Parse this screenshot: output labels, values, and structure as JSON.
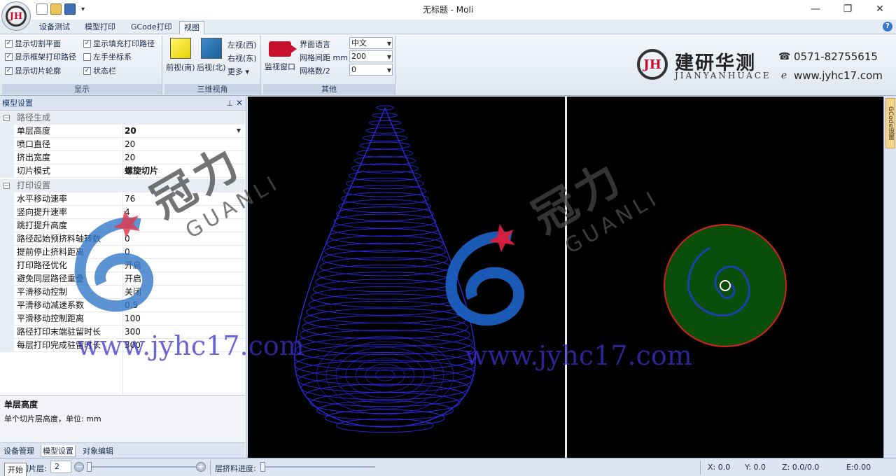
{
  "window": {
    "title": "无标题 - Moli",
    "minimize": "—",
    "maximize": "❐",
    "close": "✕"
  },
  "app_orb": {
    "monogram": "JH"
  },
  "quick_access": {
    "dropdown": "▾"
  },
  "ribbon": {
    "tabs": [
      "设备测试",
      "模型打印",
      "GCode打印",
      "视图"
    ],
    "active_tab": "视图",
    "help": "?",
    "groups": {
      "display": {
        "caption": "显示",
        "checks": [
          {
            "label": "显示切割平面",
            "checked": true
          },
          {
            "label": "显示框架打印路径",
            "checked": true
          },
          {
            "label": "显示切片轮廓",
            "checked": true
          },
          {
            "label": "显示填充打印路径",
            "checked": true
          },
          {
            "label": "左手坐标系",
            "checked": false
          },
          {
            "label": "状态栏",
            "checked": true
          }
        ]
      },
      "view3d": {
        "caption": "三维视角",
        "front": "前视(南)",
        "back": "后视(北)",
        "left": "左视(西)",
        "right": "右视(东)",
        "more": "更多 ▾"
      },
      "other": {
        "caption": "其他",
        "monitor": "监视窗口",
        "language_label": "界面语言",
        "language_value": "中文",
        "grid_spacing_label": "网格间距 mm",
        "grid_spacing_value": "200",
        "grid_count_label": "网格数/2",
        "grid_count_value": "0"
      }
    }
  },
  "brand": {
    "logo_text": "JH",
    "name_cn": "建研华测",
    "name_en": "JIANYANHUACE",
    "phone": "0571-82755615",
    "website": "www.jyhc17.com",
    "accent": "#c8102e"
  },
  "left_panel": {
    "title": "模型设置",
    "pin": "⊥",
    "close": "✕",
    "categories": [
      {
        "name": "路径生成",
        "toggle": "−",
        "props": [
          {
            "name": "单层高度",
            "value": "20",
            "selected": true
          },
          {
            "name": "喷口直径",
            "value": "20"
          },
          {
            "name": "挤出宽度",
            "value": "20"
          },
          {
            "name": "切片模式",
            "value": "螺旋切片",
            "bold": true
          }
        ]
      },
      {
        "name": "打印设置",
        "toggle": "−",
        "props": [
          {
            "name": "水平移动速率",
            "value": "76"
          },
          {
            "name": "竖向提升速率",
            "value": "4"
          },
          {
            "name": "跳打提升高度",
            "value": "5"
          },
          {
            "name": "路径起始预挤料轴转数",
            "value": "0"
          },
          {
            "name": "提前停止挤料距离",
            "value": "0"
          },
          {
            "name": "打印路径优化",
            "value": "开启"
          },
          {
            "name": "避免同层路径重叠",
            "value": "开启"
          },
          {
            "name": "平滑移动控制",
            "value": "关闭"
          },
          {
            "name": "平滑移动减速系数",
            "value": "0.5"
          },
          {
            "name": "平滑移动控制距离",
            "value": "100"
          },
          {
            "name": "路径打印末端驻留时长",
            "value": "300"
          },
          {
            "name": "每层打印完成驻留时长",
            "value": "300"
          }
        ]
      }
    ],
    "description_title": "单层高度",
    "description_text": "单个切片层高度，单位: mm",
    "tabs": [
      "设备管理",
      "模型设置",
      "对象编辑"
    ],
    "active_tab": "模型设置"
  },
  "right_strip": {
    "tab": "GCode设置"
  },
  "watermark": {
    "cn": "冠力",
    "en": "GUANLI",
    "url": "www.jyhc17.com"
  },
  "statusbar": {
    "start_tip": "开始",
    "slice_layer_label": "切片层:",
    "slice_layer_value": "2",
    "minus": "−",
    "plus": "+",
    "extrude_label": "层挤料进度:",
    "x": "X: 0.0",
    "y": "Y: 0.0",
    "z": "Z: 0.0/0.0",
    "e": "E:0.00"
  },
  "colors": {
    "mesh": "#2a2ae0",
    "disk_fill": "#0b4d0b",
    "disk_border": "#d42020",
    "spiral": "#1e3fb0"
  }
}
